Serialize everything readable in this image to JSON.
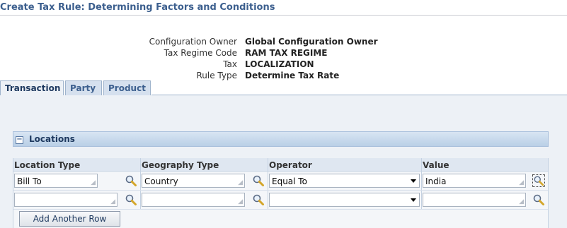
{
  "page_title": "Create Tax Rule: Determining Factors and Conditions",
  "info": [
    {
      "label": "Configuration Owner",
      "value": "Global Configuration Owner"
    },
    {
      "label": "Tax Regime Code",
      "value": "RAM TAX REGIME"
    },
    {
      "label": "Tax",
      "value": "LOCALIZATION"
    },
    {
      "label": "Rule Type",
      "value": "Determine Tax Rate"
    }
  ],
  "tabs": [
    {
      "label": "Transaction",
      "active": true
    },
    {
      "label": "Party",
      "active": false
    },
    {
      "label": "Product",
      "active": false
    }
  ],
  "section": {
    "title": "Locations",
    "collapse_icon": "minus-box-icon"
  },
  "table": {
    "headers": [
      "Location Type",
      "Geography Type",
      "Operator",
      "Value"
    ],
    "rows": [
      {
        "location_type": "Bill To",
        "geography_type": "Country",
        "operator": "Equal To",
        "value": "India"
      },
      {
        "location_type": "",
        "geography_type": "",
        "operator": "",
        "value": ""
      }
    ]
  },
  "add_row_label": "Add Another Row",
  "icons": {
    "lov": "search-magnifier-icon",
    "dropdown": "chevron-down-icon"
  },
  "colors": {
    "title": "#3c5f8e",
    "tab_active": "#edf1f6",
    "section_bar": "#b9cfe6",
    "content_bg": "#edf1f6"
  }
}
